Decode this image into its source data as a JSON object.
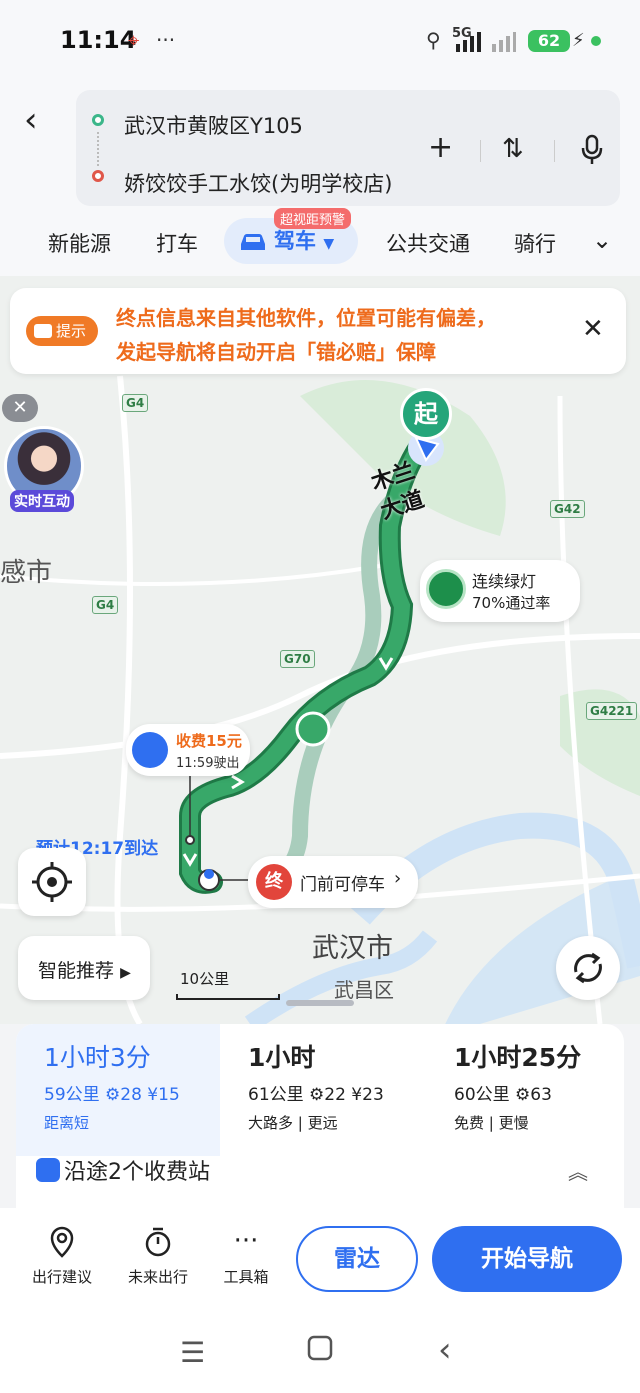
{
  "status_bar": {
    "time": "11:14",
    "dots": "···",
    "network": "5G",
    "battery": "62"
  },
  "header": {
    "origin": "武汉市黄陂区Y105",
    "destination": "娇饺饺手工水饺(为明学校店)"
  },
  "modes": {
    "items": [
      "新能源",
      "打车",
      "驾车",
      "公共交通",
      "骑行"
    ],
    "active_badge": "超视距预警"
  },
  "map": {
    "notice": {
      "tag": "提示",
      "line1": "终点信息来自其他软件，位置可能有偏差，",
      "line2": "发起导航将自动开启「错必赔」保障"
    },
    "avatar_label": "实时互动",
    "road_name": "木兰大道",
    "shields": [
      "G4",
      "G4",
      "G70",
      "G42",
      "G4221"
    ],
    "place_labels": [
      "感市",
      "武汉市",
      "武昌区"
    ],
    "start_marker": "起",
    "green_light": {
      "title": "连续绿灯",
      "rate": "70%通过率"
    },
    "toll": {
      "fee": "收费15元",
      "exit_time": "11:59驶出"
    },
    "eta": "预计12:17到达",
    "end": {
      "marker": "终",
      "text": "门前可停车"
    },
    "smart_recommend": "智能推荐",
    "scale": "10公里"
  },
  "plans": [
    {
      "duration": "1小时3分",
      "meta": "59公里  ⚙28  ¥15",
      "tags": "距离短"
    },
    {
      "duration": "1小时",
      "meta": "61公里  ⚙22  ¥23",
      "tags": "大路多 | 更远"
    },
    {
      "duration": "1小时25分",
      "meta": "60公里  ⚙63",
      "tags": "免费 | 更慢"
    }
  ],
  "tolls_summary": "沿途2个收费站",
  "actions": {
    "trip_advice": "出行建议",
    "future_trip": "未来出行",
    "toolbox": "工具箱",
    "radar": "雷达",
    "start_nav": "开始导航"
  },
  "colors": {
    "accent": "#2f6ff0",
    "route_green": "#2e9a5a",
    "warning": "#ee6b1c",
    "danger": "#e2453b"
  }
}
